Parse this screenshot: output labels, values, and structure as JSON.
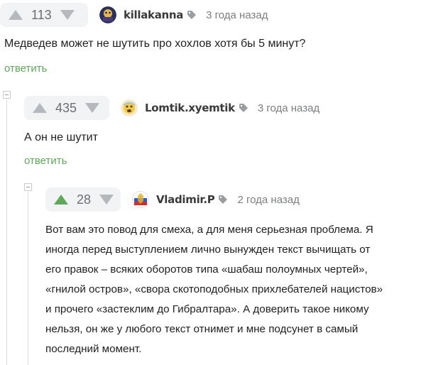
{
  "comments": [
    {
      "votes": "113",
      "username": "killakanna",
      "time": "3 года назад",
      "text": "Медведев может не шутить про хохлов хотя бы 5 минут?",
      "reply_label": "ответить"
    },
    {
      "votes": "435",
      "username": "Lomtik.xyemtik",
      "time": "3 года назад",
      "text": "А он не шутит",
      "reply_label": "ответить"
    },
    {
      "votes": "28",
      "username": "Vladimir.P",
      "time": "2 года назад",
      "text_lines": [
        "Вот вам это повод для смеха, а для меня серьезная проблема. Я",
        "иногда перед выступлением лично вынужден текст вычищать от",
        "его правок – всяких оборотов типа «шабаш полоумных чертей»,",
        "«гнилой остров», «свора скотоподобных прихлебателей нацистов»",
        "и прочего «застеклим до Гибралтара». А доверить такое никому",
        "нельзя, он же у любого текст отнимет и мне подсунет в самый",
        "последний момент."
      ]
    }
  ],
  "colors": {
    "accent": "#5fa95a",
    "vote_bg": "#f2f3f5",
    "arrow": "#b5b8bd"
  },
  "icons": {
    "upvote": "triangle-up-icon",
    "downvote": "triangle-down-icon",
    "tag": "tag-icon",
    "collapse": "collapse-minus-icon"
  }
}
